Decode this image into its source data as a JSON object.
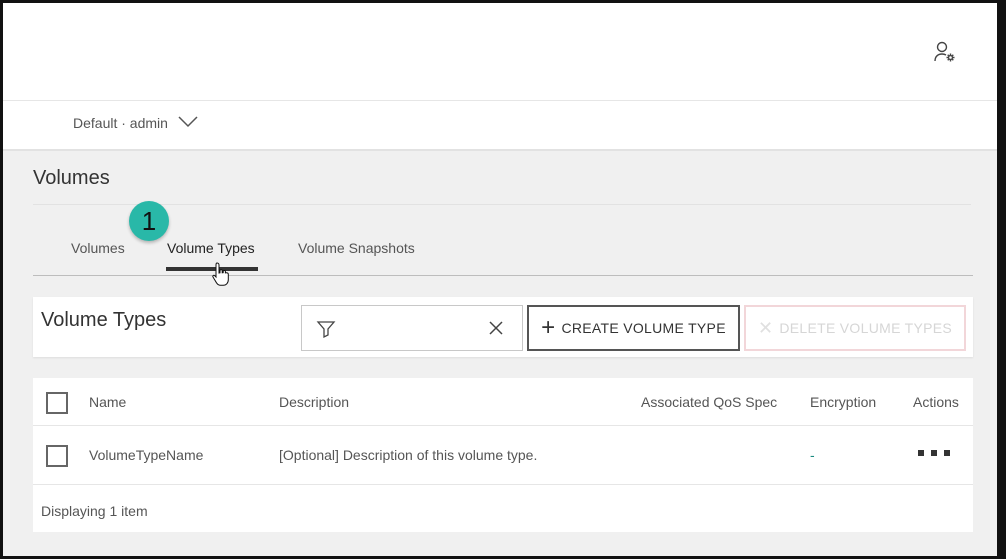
{
  "scope": {
    "label": "Default · admin"
  },
  "page": {
    "title": "Volumes"
  },
  "tabs": [
    {
      "label": "Volumes",
      "active": false
    },
    {
      "label": "Volume Types",
      "active": true
    },
    {
      "label": "Volume Snapshots",
      "active": false
    }
  ],
  "annotation": {
    "step": "1",
    "color": "#29b8a8"
  },
  "toolbar": {
    "section_title": "Volume Types",
    "filter_value": "",
    "create_label": "CREATE VOLUME TYPE",
    "delete_label": "DELETE VOLUME TYPES",
    "delete_enabled": false
  },
  "table": {
    "columns": [
      "Name",
      "Description",
      "Associated QoS Spec",
      "Encryption",
      "Actions"
    ],
    "rows": [
      {
        "name": "VolumeTypeName",
        "description": "[Optional] Description of this volume type.",
        "qos_spec": "",
        "encryption": "-"
      }
    ],
    "footer": "Displaying 1 item"
  },
  "icons": {
    "user_settings": "user-settings-icon",
    "filter": "filter-icon",
    "clear": "close-icon",
    "chevron": "chevron-down-icon",
    "actions": "more-actions-icon"
  }
}
